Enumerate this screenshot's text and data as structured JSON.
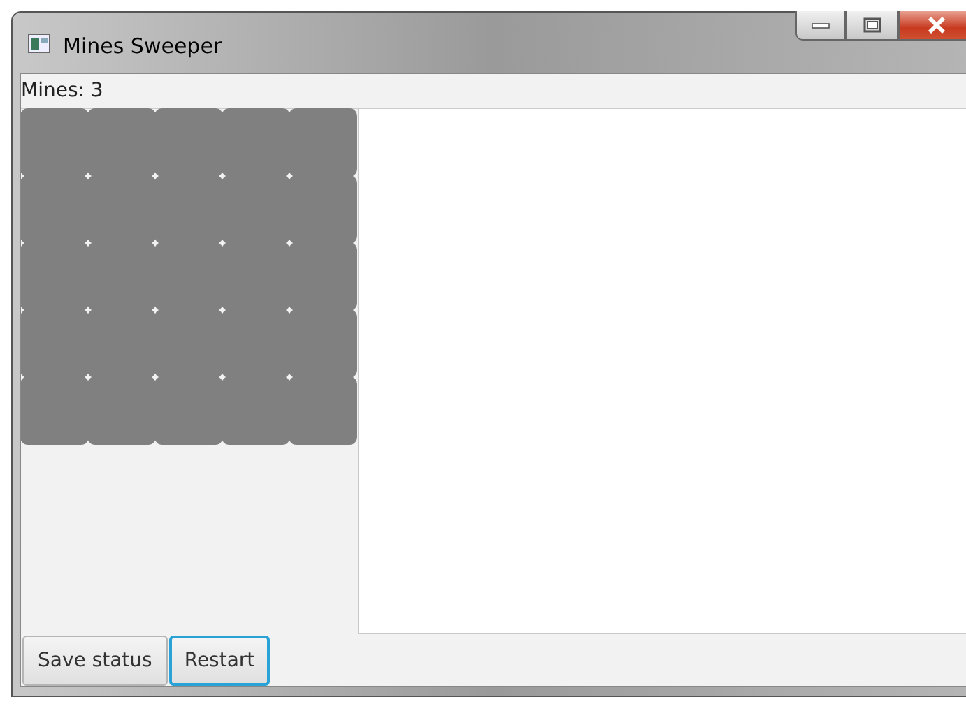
{
  "window": {
    "title": "Mines Sweeper"
  },
  "mines_label": "Mines: 3",
  "board": {
    "rows": [
      [
        {
          "revealed": false
        },
        {
          "revealed": false
        },
        {
          "revealed": false
        },
        {
          "revealed": false
        },
        {
          "revealed": false
        }
      ],
      [
        {
          "revealed": false
        },
        {
          "revealed": false
        },
        {
          "revealed": false
        },
        {
          "revealed": false
        },
        {
          "revealed": false
        }
      ],
      [
        {
          "revealed": false
        },
        {
          "revealed": false
        },
        {
          "revealed": false
        },
        {
          "revealed": false
        },
        {
          "revealed": false
        }
      ],
      [
        {
          "revealed": false
        },
        {
          "revealed": false
        },
        {
          "revealed": false
        },
        {
          "revealed": false
        },
        {
          "revealed": false
        }
      ],
      [
        {
          "revealed": false
        },
        {
          "revealed": false
        },
        {
          "revealed": false
        },
        {
          "revealed": false
        },
        {
          "revealed": false
        }
      ]
    ]
  },
  "buttons": [
    {
      "label": "Save status",
      "focused": false
    },
    {
      "label": "Restart",
      "focused": true
    }
  ]
}
